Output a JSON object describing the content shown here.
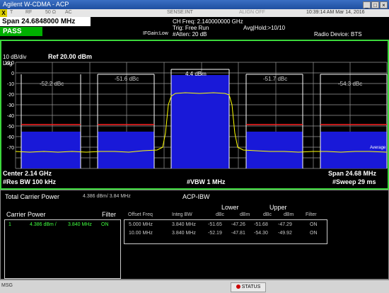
{
  "window": {
    "title": "Agilent W-CDMA - ACP"
  },
  "status_bar": {
    "items": [
      "T",
      "RF",
      "50 Ω",
      "AC",
      "SENSE:INT",
      "ALIGN OFF"
    ],
    "datetime": "10:39:14 AM Mar 14, 2016"
  },
  "header": {
    "span": "Span 24.6848000 MHz",
    "pass": "PASS",
    "ifgain": "IFGain:Low",
    "ch_freq": "CH Freq: 2.140000000 GHz",
    "trig": "Trig: Free Run",
    "atten": "#Atten: 20 dB",
    "avg_hold": "Avg|Hold:>10/10",
    "radio_device": "Radio Device: BTS"
  },
  "plot": {
    "scale": "10 dB/div",
    "log": "Log",
    "ref": "Ref 20.00 dBm",
    "y_ticks": [
      "10.0",
      "0",
      "-10",
      "-20",
      "-30",
      "-40",
      "-50",
      "-60",
      "-70"
    ],
    "carrier_label": "4.4 dBm",
    "offset_labels": [
      "-52.2 dBc",
      "-51.6 dBc",
      "-51.7 dBc",
      "-54.3 dBc"
    ],
    "average_label": "Average",
    "center": "Center  2.14 GHz",
    "res_bw": "#Res BW  100 kHz",
    "vbw": "#VBW  1 MHz",
    "span": "Span 24.68 MHz",
    "sweep": "#Sweep  29 ms",
    "colors": {
      "band": "#1919d8",
      "trace": "#ffff00",
      "limit": "#ff2020",
      "border": "#3cd83c"
    }
  },
  "results": {
    "total_carrier_power_label": "Total Carrier Power",
    "total_carrier_power_value": "4.386 dBm/ 3.84 MHz",
    "mode": "ACP-IBW",
    "carrier_power_label": "Carrier Power",
    "filter_label": "Filter",
    "carrier_row": {
      "num": "1",
      "power": "4.386 dBm /",
      "bw": "3.840 MHz",
      "filter": "ON"
    },
    "lower_label": "Lower",
    "upper_label": "Upper",
    "columns": [
      "Offset Freq",
      "Integ BW",
      "dBc",
      "dBm",
      "dBc",
      "dBm",
      "Filter"
    ],
    "rows": [
      [
        "5.000 MHz",
        "3.840 MHz",
        "-51.65",
        "-47.26",
        "-51.68",
        "-47.29",
        "ON"
      ],
      [
        "10.00 MHz",
        "3.840 MHz",
        "-52.19",
        "-47.81",
        "-54.30",
        "-49.92",
        "ON"
      ]
    ]
  },
  "bottom": {
    "msg": "MSG",
    "status": "STATUS"
  }
}
